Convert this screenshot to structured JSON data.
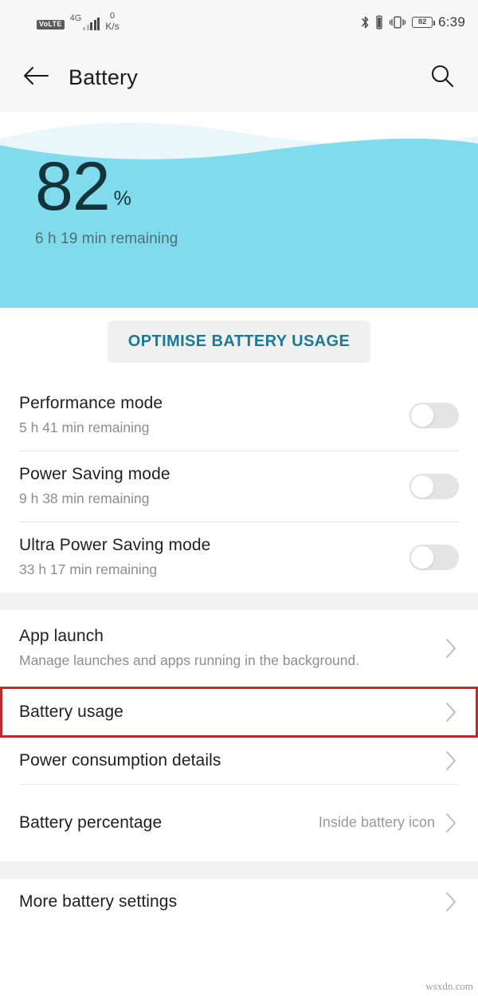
{
  "statusbar": {
    "volte_label": "VoLTE",
    "network_type": "4G",
    "net_speed_value": "0",
    "net_speed_unit": "K/s",
    "battery_level": "82",
    "time": "6:39",
    "icons": [
      "bluetooth-icon",
      "bluetooth-battery-icon",
      "vibrate-icon",
      "battery-icon"
    ]
  },
  "appbar": {
    "back_icon": "back-arrow-icon",
    "title": "Battery",
    "search_icon": "search-icon"
  },
  "hero": {
    "percent": "82",
    "percent_symbol": "%",
    "remaining": "6 h 19 min remaining",
    "background_color": "#80dcec",
    "wave_color": "#eaf7fa"
  },
  "optimise": {
    "label": "OPTIMISE BATTERY USAGE",
    "text_color": "#1b7a93",
    "background_color": "#f0f0f0"
  },
  "modes": [
    {
      "title": "Performance mode",
      "subtitle": "5 h 41 min remaining",
      "enabled": false
    },
    {
      "title": "Power Saving mode",
      "subtitle": "9 h 38 min remaining",
      "enabled": false
    },
    {
      "title": "Ultra Power Saving mode",
      "subtitle": "33 h 17 min remaining",
      "enabled": false
    }
  ],
  "items": {
    "app_launch": {
      "title": "App launch",
      "subtitle": "Manage launches and apps running in the background."
    },
    "battery_usage": {
      "title": "Battery usage"
    },
    "power_consumption": {
      "title": "Power consumption details"
    },
    "battery_percentage": {
      "title": "Battery percentage",
      "value": "Inside battery icon"
    },
    "more_settings": {
      "title": "More battery settings"
    }
  },
  "annotation": {
    "highlight_color": "#c1272d",
    "target": "battery-usage-row"
  },
  "watermark": {
    "text": "wsxdn.com"
  }
}
